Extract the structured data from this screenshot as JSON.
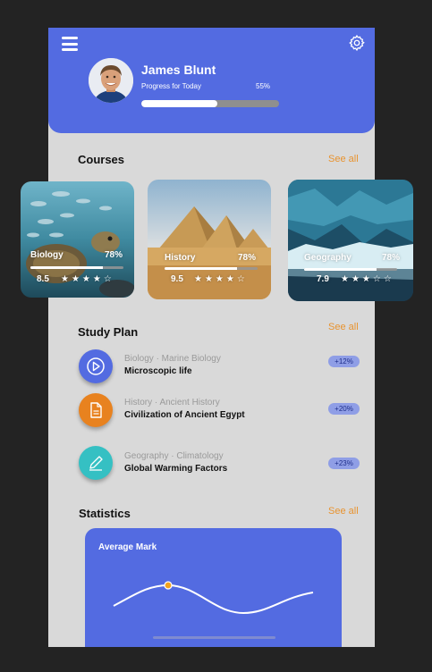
{
  "profile": {
    "name": "James Blunt",
    "progress_label": "Progress for Today",
    "progress_text": "55%",
    "progress_value": 0.55
  },
  "icons": {
    "menu": "menu-icon",
    "settings": "gear-icon"
  },
  "colors": {
    "accent": "#536be1",
    "link": "#e8932f",
    "background": "#d9d9d9"
  },
  "courses": {
    "title": "Courses",
    "see_all": "See all",
    "items": [
      {
        "name": "Biology",
        "percent": "78%",
        "progress": 0.78,
        "rating": "8.5",
        "stars": "★★★★☆"
      },
      {
        "name": "History",
        "percent": "78%",
        "progress": 0.78,
        "rating": "9.5",
        "stars": "★★★★☆"
      },
      {
        "name": "Geography",
        "percent": "78%",
        "progress": 0.78,
        "rating": "7.9",
        "stars": "★★★☆☆"
      }
    ]
  },
  "study_plan": {
    "title": "Study Plan",
    "see_all": "See all",
    "items": [
      {
        "category": "Biology · Marine Biology",
        "topic": "Microscopic life",
        "change": "+12%",
        "icon": "play-icon",
        "color": "#536be1"
      },
      {
        "category": "History · Ancient History",
        "topic": "Civilization of Ancient Egypt",
        "change": "+20%",
        "icon": "document-icon",
        "color": "#e8821f"
      },
      {
        "category": "Geography · Climatology",
        "topic": "Global Warming Factors",
        "change": "+23%",
        "icon": "pencil-icon",
        "color": "#35c0c3"
      }
    ]
  },
  "statistics": {
    "title": "Statistics",
    "see_all": "See all",
    "card_title": "Average Mark"
  }
}
